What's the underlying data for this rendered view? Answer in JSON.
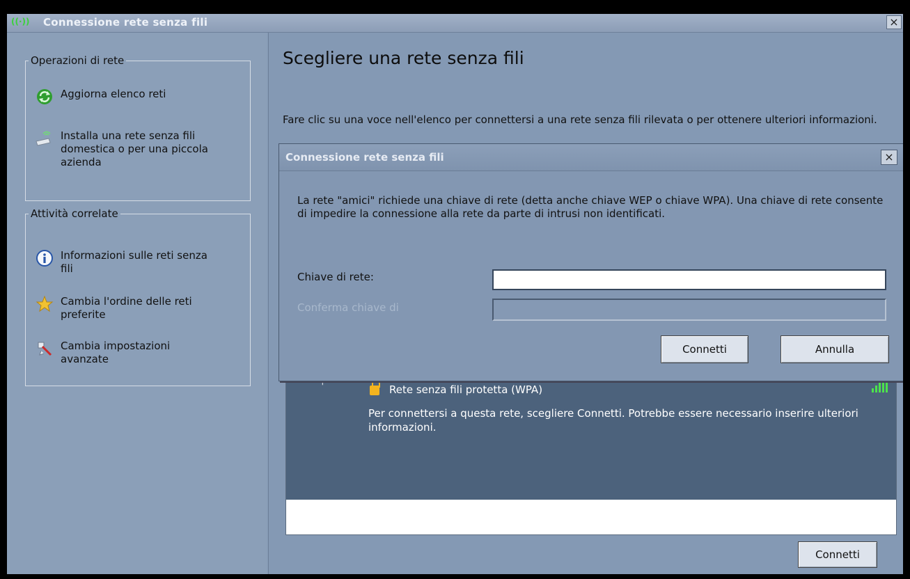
{
  "window": {
    "title": "Connessione rete senza fili",
    "close_label": "×"
  },
  "sidebar": {
    "network_tasks": {
      "title": "Operazioni di rete",
      "items": [
        {
          "label": "Aggiorna elenco reti",
          "icon": "refresh-icon"
        },
        {
          "label": "Installa una rete senza fili domestica o per una piccola azienda",
          "icon": "wireless-setup-icon"
        }
      ]
    },
    "related_tasks": {
      "title": "Attività correlate",
      "items": [
        {
          "label": "Informazioni sulle reti senza fili",
          "icon": "info-icon"
        },
        {
          "label": "Cambia l'ordine delle reti preferite",
          "icon": "star-icon"
        },
        {
          "label": "Cambia impostazioni avanzate",
          "icon": "settings-icon"
        }
      ]
    }
  },
  "main": {
    "heading": "Scegliere una rete senza fili",
    "intro": "Fare clic su una voce nell'elenco per connettersi a una rete senza fili rilevata o per ottenere ulteriori informazioni.",
    "selected_network": {
      "name": "Rete senza fili protetta (WPA)",
      "description": "Per connettersi a questa rete, scegliere Connetti. Potrebbe essere necessario inserire ulteriori informazioni.",
      "signal_bars": 5
    },
    "connect_label": "Connetti"
  },
  "dialog": {
    "title": "Connessione rete senza fili",
    "close_label": "×",
    "message": "La rete \"amici\" richiede una chiave di rete (detta anche chiave WEP o chiave WPA). Una chiave di rete consente di impedire la connessione alla rete da parte di intrusi non identificati.",
    "key_label": "Chiave di rete:",
    "key_value": "",
    "confirm_label": "Conferma chiave di",
    "confirm_value": "",
    "connect_label": "Connetti",
    "cancel_label": "Annulla"
  },
  "colors": {
    "accent": "#4c627c",
    "signal": "#4ce34c",
    "lock": "#f3b41f"
  }
}
